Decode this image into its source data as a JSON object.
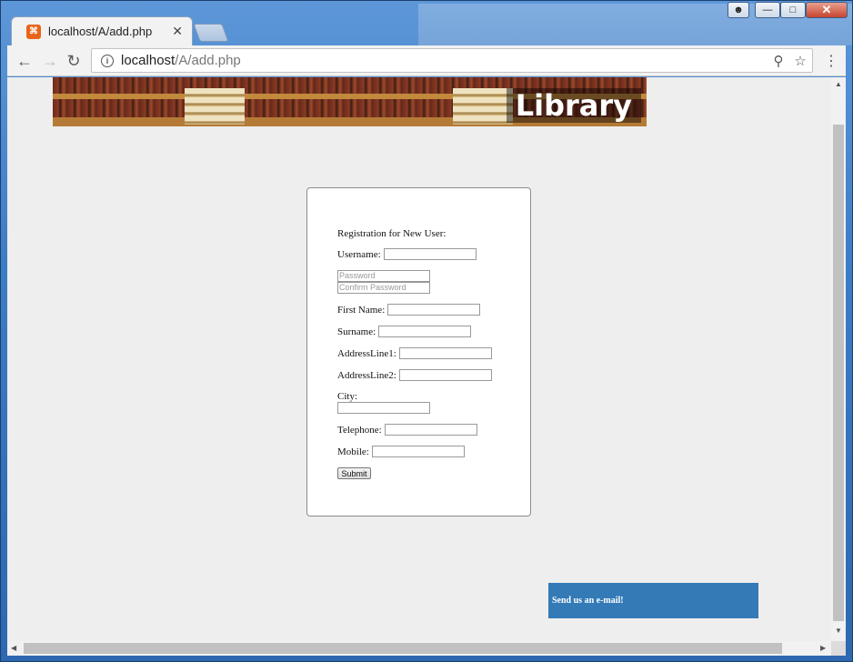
{
  "browser": {
    "tab_title": "localhost/A/add.php",
    "tab_favicon_text": "⌘",
    "url_host": "localhost",
    "url_path": "/A/add.php"
  },
  "page": {
    "banner_title": "Library",
    "form": {
      "heading": "Registration for New User:",
      "username_label": "Username:",
      "password_placeholder": "Password",
      "confirm_password_placeholder": "Confirm Password",
      "first_name_label": "First Name:",
      "surname_label": "Surname:",
      "address1_label": "AddressLine1:",
      "address2_label": "AddressLine2:",
      "city_label": "City:",
      "telephone_label": "Telephone:",
      "mobile_label": "Mobile:",
      "submit_label": "Submit"
    },
    "email_box": "Send us an e-mail!"
  },
  "colors": {
    "accent_blue": "#337ab7",
    "page_bg": "#eeeeee"
  },
  "icons": {
    "back": "arrow-left-icon",
    "forward": "arrow-right-icon",
    "reload": "reload-icon",
    "info": "info-icon",
    "zoom": "zoom-icon",
    "bookmark": "star-icon",
    "menu": "kebab-menu-icon"
  }
}
